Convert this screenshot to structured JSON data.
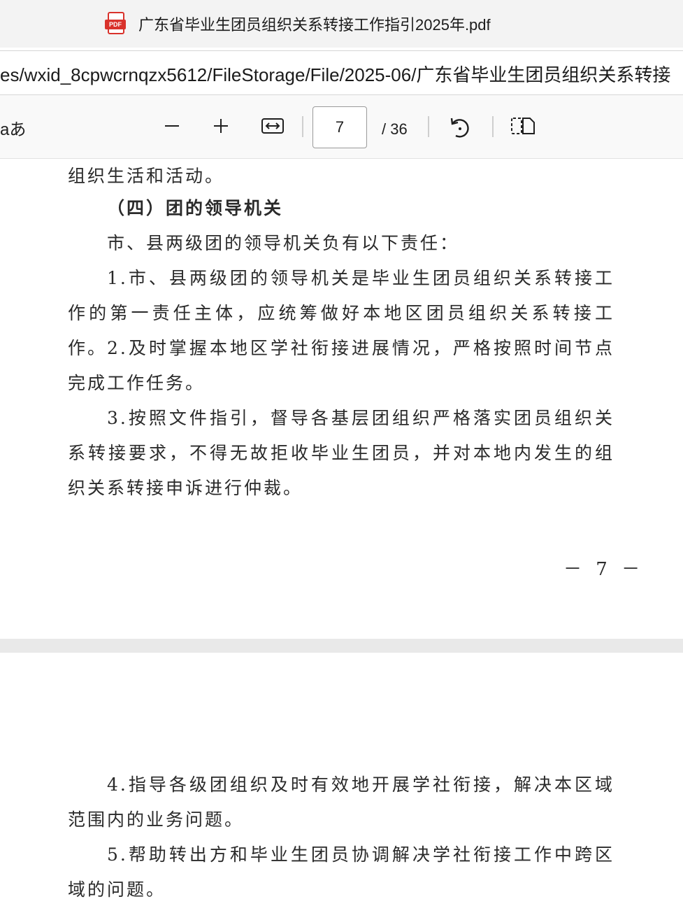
{
  "tab": {
    "title": "广东省毕业生团员组织关系转接工作指引2025年.pdf",
    "icon": "pdf-file-icon",
    "icon_label": "PDF"
  },
  "address": {
    "path": "es/wxid_8cpwcrnqzx5612/FileStorage/File/2025-06/广东省毕业生团员组织关系转接"
  },
  "toolbar": {
    "read_aloud_label": "aあ",
    "page_current": "7",
    "page_total": "/ 36"
  },
  "pages": [
    {
      "paragraphs": [
        "组织生活和活动。",
        "（四）团的领导机关",
        "市、县两级团的领导机关负有以下责任：",
        "1.市、县两级团的领导机关是毕业生团员组织关系转接工作的第一责任主体，应统筹做好本地区团员组织关系转接工作。",
        "2.及时掌握本地区学社衔接进展情况，严格按照时间节点完成工作任务。",
        "3.按照文件指引，督导各基层团组织严格落实团员组织关系转接要求，不得无故拒收毕业生团员，并对本地内发生的组织关系转接申诉进行仲裁。"
      ],
      "page_number": "－ 7 －"
    },
    {
      "paragraphs": [
        "4.指导各级团组织及时有效地开展学社衔接，解决本区域范围内的业务问题。",
        "5.帮助转出方和毕业生团员协调解决学社衔接工作中跨区域的问题。"
      ]
    }
  ]
}
